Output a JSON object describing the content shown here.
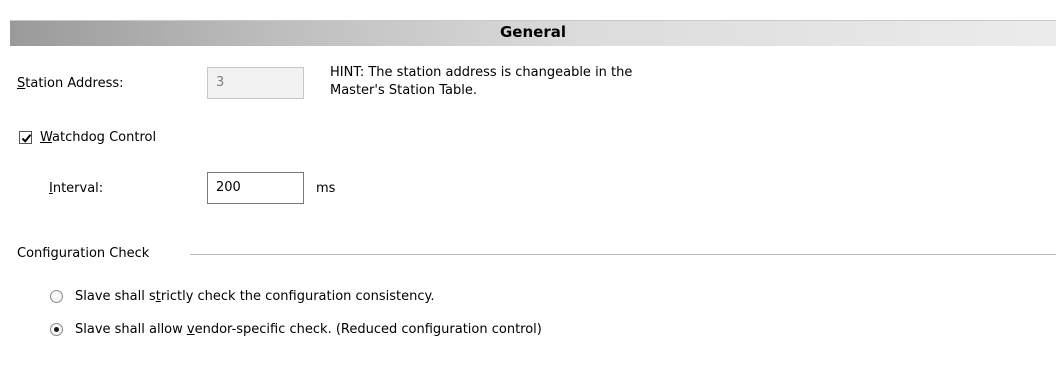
{
  "header": {
    "title": "General"
  },
  "station_address": {
    "label_prefix": "",
    "label_accel": "S",
    "label_rest": "tation Address:",
    "value": "3",
    "hint_line1": "HINT: The station address is changeable in the",
    "hint_line2": "Master's Station Table."
  },
  "watchdog": {
    "checked": true,
    "label_accel": "W",
    "label_rest": "atchdog Control",
    "interval_accel": "I",
    "interval_rest": "nterval:",
    "interval_value": "200",
    "unit": "ms"
  },
  "config_check": {
    "group_label": "Configuration Check",
    "option1": {
      "pre": "Slave shall s",
      "accel": "t",
      "post": "rictly check the configuration consistency.",
      "selected": false
    },
    "option2": {
      "pre": "Slave shall allow ",
      "accel": "v",
      "post": "endor-specific check. (Reduced configuration control)",
      "selected": true
    }
  }
}
